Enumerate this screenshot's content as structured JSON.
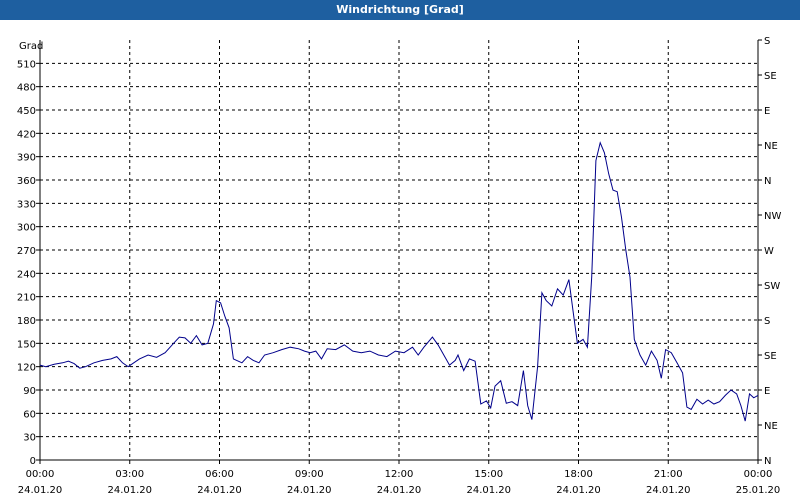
{
  "window": {
    "title": "Windrichtung [Grad]"
  },
  "chart_data": {
    "type": "line",
    "title": "Windrichtung [Grad]",
    "ylabel": "Grad",
    "ylim": [
      0,
      540
    ],
    "y_ticks": [
      0,
      30,
      60,
      90,
      120,
      150,
      180,
      210,
      240,
      270,
      300,
      330,
      360,
      390,
      420,
      450,
      480,
      510
    ],
    "right_axis_labels": [
      {
        "value": 0,
        "label": "N"
      },
      {
        "value": 45,
        "label": "NE"
      },
      {
        "value": 90,
        "label": "E"
      },
      {
        "value": 135,
        "label": "SE"
      },
      {
        "value": 180,
        "label": "S"
      },
      {
        "value": 225,
        "label": "SW"
      },
      {
        "value": 270,
        "label": "W"
      },
      {
        "value": 315,
        "label": "NW"
      },
      {
        "value": 360,
        "label": "N"
      },
      {
        "value": 405,
        "label": "NE"
      },
      {
        "value": 450,
        "label": "E"
      },
      {
        "value": 495,
        "label": "SE"
      },
      {
        "value": 540,
        "label": "S"
      }
    ],
    "xlim": [
      0,
      24
    ],
    "x_ticks": [
      {
        "hour": 0,
        "time": "00:00",
        "date": "24.01.20"
      },
      {
        "hour": 3,
        "time": "03:00",
        "date": "24.01.20"
      },
      {
        "hour": 6,
        "time": "06:00",
        "date": "24.01.20"
      },
      {
        "hour": 9,
        "time": "09:00",
        "date": "24.01.20"
      },
      {
        "hour": 12,
        "time": "12:00",
        "date": "24.01.20"
      },
      {
        "hour": 15,
        "time": "15:00",
        "date": "24.01.20"
      },
      {
        "hour": 18,
        "time": "18:00",
        "date": "24.01.20"
      },
      {
        "hour": 21,
        "time": "21:00",
        "date": "24.01.20"
      },
      {
        "hour": 24,
        "time": "00:00",
        "date": "25.01.20"
      }
    ],
    "grid": true,
    "line_color": "#00008b",
    "series": [
      {
        "values": [
          [
            0.0,
            122
          ],
          [
            0.2,
            120
          ],
          [
            0.5,
            123
          ],
          [
            0.8,
            125
          ],
          [
            1.0,
            127
          ],
          [
            1.2,
            124
          ],
          [
            1.4,
            118
          ],
          [
            1.6,
            120
          ],
          [
            1.9,
            125
          ],
          [
            2.2,
            128
          ],
          [
            2.5,
            130
          ],
          [
            2.7,
            133
          ],
          [
            2.9,
            125
          ],
          [
            3.1,
            120
          ],
          [
            3.3,
            125
          ],
          [
            3.5,
            130
          ],
          [
            3.8,
            135
          ],
          [
            4.1,
            132
          ],
          [
            4.4,
            138
          ],
          [
            4.7,
            150
          ],
          [
            4.9,
            158
          ],
          [
            5.1,
            157
          ],
          [
            5.3,
            150
          ],
          [
            5.5,
            160
          ],
          [
            5.7,
            148
          ],
          [
            5.9,
            150
          ],
          [
            6.1,
            175
          ],
          [
            6.2,
            205
          ],
          [
            6.35,
            202
          ],
          [
            6.5,
            185
          ],
          [
            6.65,
            170
          ],
          [
            6.8,
            130
          ],
          [
            7.1,
            125
          ],
          [
            7.3,
            133
          ],
          [
            7.5,
            128
          ],
          [
            7.7,
            125
          ],
          [
            7.9,
            135
          ],
          [
            8.2,
            138
          ],
          [
            8.5,
            142
          ],
          [
            8.8,
            145
          ],
          [
            9.1,
            143
          ],
          [
            9.3,
            140
          ],
          [
            9.5,
            138
          ],
          [
            9.7,
            140
          ],
          [
            9.9,
            130
          ],
          [
            10.1,
            143
          ],
          [
            10.4,
            142
          ],
          [
            10.7,
            148
          ],
          [
            11.0,
            140
          ],
          [
            11.3,
            138
          ],
          [
            11.6,
            140
          ],
          [
            11.9,
            135
          ],
          [
            12.2,
            133
          ],
          [
            12.5,
            140
          ],
          [
            12.8,
            138
          ],
          [
            13.1,
            145
          ],
          [
            13.3,
            135
          ],
          [
            13.5,
            145
          ],
          [
            13.8,
            158
          ],
          [
            14.0,
            148
          ],
          [
            14.2,
            135
          ],
          [
            14.4,
            122
          ],
          [
            14.6,
            128
          ],
          [
            14.7,
            135
          ],
          [
            14.9,
            115
          ],
          [
            15.1,
            130
          ],
          [
            15.3,
            127
          ],
          [
            15.5,
            72
          ],
          [
            15.7,
            76
          ],
          [
            15.85,
            67
          ],
          [
            16.0,
            95
          ],
          [
            16.2,
            102
          ],
          [
            16.4,
            73
          ],
          [
            16.6,
            75
          ],
          [
            16.8,
            70
          ],
          [
            17.0,
            115
          ],
          [
            17.15,
            70
          ],
          [
            17.3,
            52
          ],
          [
            17.5,
            120
          ],
          [
            17.65,
            215
          ],
          [
            17.8,
            205
          ],
          [
            18.0,
            198
          ],
          [
            18.2,
            220
          ],
          [
            18.4,
            212
          ],
          [
            18.6,
            232
          ],
          [
            18.75,
            190
          ],
          [
            18.9,
            150
          ],
          [
            19.1,
            155
          ],
          [
            19.25,
            145
          ],
          [
            19.4,
            235
          ],
          [
            19.55,
            385
          ],
          [
            19.7,
            408
          ],
          [
            19.85,
            395
          ],
          [
            20.0,
            368
          ],
          [
            20.15,
            347
          ],
          [
            20.3,
            345
          ],
          [
            20.45,
            312
          ],
          [
            20.6,
            270
          ],
          [
            20.75,
            235
          ],
          [
            20.9,
            155
          ],
          [
            21.1,
            135
          ],
          [
            21.3,
            122
          ],
          [
            21.5,
            140
          ],
          [
            21.7,
            128
          ],
          [
            21.85,
            105
          ],
          [
            22.0,
            142
          ],
          [
            22.2,
            138
          ],
          [
            22.4,
            125
          ],
          [
            22.6,
            112
          ],
          [
            22.75,
            68
          ],
          [
            22.9,
            65
          ],
          [
            23.1,
            78
          ],
          [
            23.3,
            72
          ],
          [
            23.5,
            77
          ],
          [
            23.7,
            72
          ],
          [
            23.9,
            75
          ],
          [
            24.1,
            83
          ],
          [
            24.3,
            90
          ],
          [
            24.5,
            85
          ],
          [
            24.65,
            70
          ],
          [
            24.8,
            50
          ],
          [
            24.95,
            85
          ],
          [
            25.1,
            80
          ],
          [
            25.25,
            83
          ]
        ]
      }
    ]
  }
}
